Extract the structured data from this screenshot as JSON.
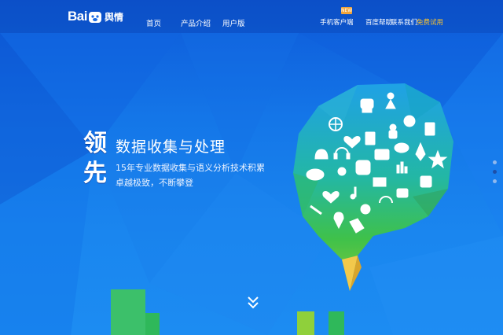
{
  "brand": {
    "logo_text": "Bai",
    "logo_sub": "舆情"
  },
  "nav": {
    "items": [
      {
        "label": "首页"
      },
      {
        "label": "产品介绍"
      },
      {
        "label": "用户版"
      }
    ],
    "right": [
      {
        "label": "手机客户端"
      },
      {
        "label": "百度帮助"
      },
      {
        "label": "联系我们"
      },
      {
        "label": "免费试用"
      }
    ],
    "new_badge": "NEW"
  },
  "hero": {
    "big_chars": [
      "领",
      "先"
    ],
    "title": "数据收集与处理",
    "lines": [
      "15年专业数据收集与语义分析技术积累",
      "卓越极致，不断攀登"
    ]
  },
  "carousel": {
    "count": 3,
    "active_index": 1
  },
  "colors": {
    "accent": "#f6c231",
    "bg_top": "#0e5ad9",
    "bg_bottom": "#1c8cf2",
    "green": "#2cc05c"
  },
  "icons": [
    "paw-icon",
    "telephone-icon",
    "person-icon",
    "globe-icon",
    "heart-icon",
    "document-icon",
    "weibo-icon",
    "headphones-icon",
    "bell-icon",
    "music-icon",
    "chat-icon",
    "rocket-icon",
    "star-icon",
    "cloud-icon",
    "sun-icon",
    "baidu-paw-icon",
    "camera-icon",
    "mail-icon",
    "chart-icon",
    "rss-icon",
    "map-pin-icon",
    "tag-icon",
    "wrench-icon",
    "chevron-down-icon"
  ]
}
